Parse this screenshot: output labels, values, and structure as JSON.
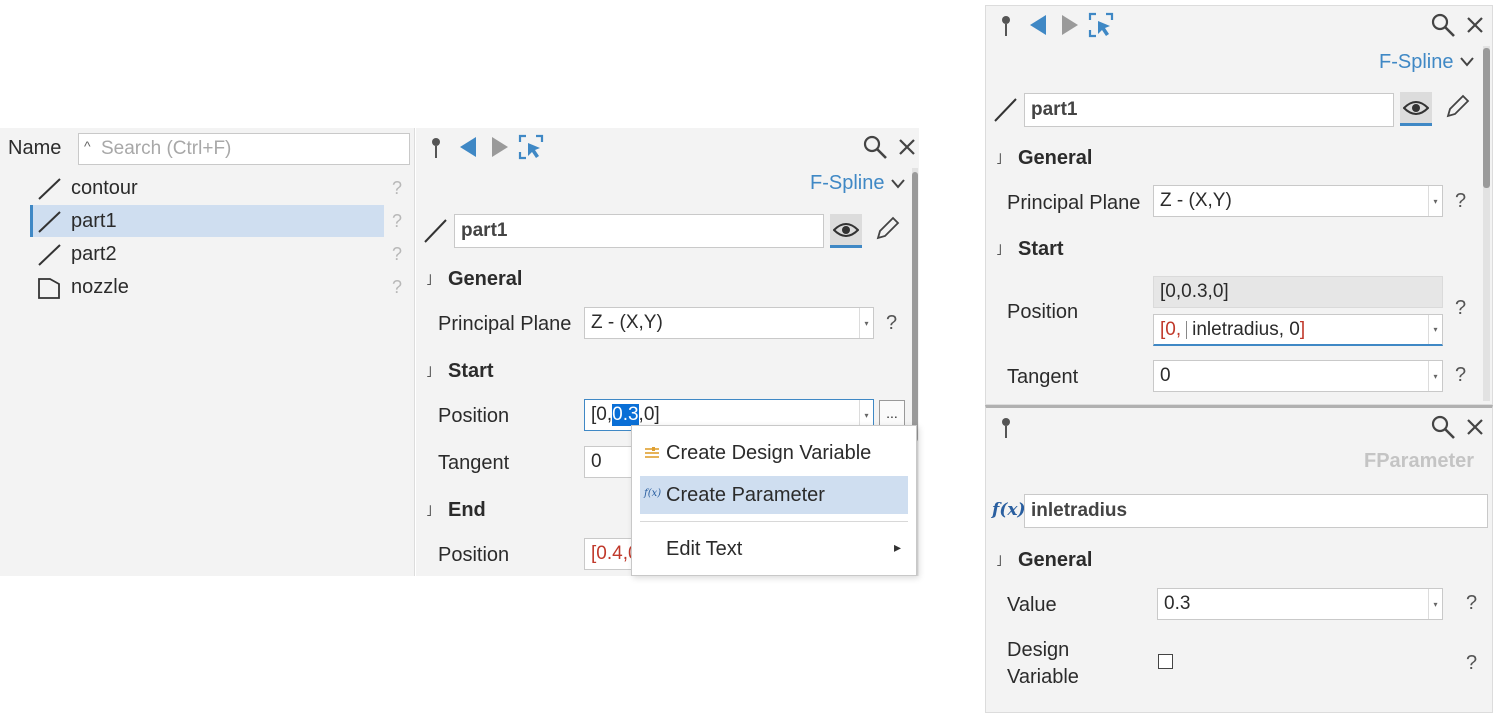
{
  "tree": {
    "header_label": "Name",
    "search_placeholder": "Search (Ctrl+F)",
    "items": [
      {
        "label": "contour",
        "help": "?"
      },
      {
        "label": "part1",
        "help": "?"
      },
      {
        "label": "part2",
        "help": "?"
      },
      {
        "label": "nozzle",
        "help": "?"
      }
    ]
  },
  "left_props": {
    "type_label": "F-Spline",
    "name_value": "part1",
    "sections": {
      "general": "General",
      "start": "Start",
      "end": "End"
    },
    "principal_plane_label": "Principal Plane",
    "principal_plane_value": "Z - (X,Y)",
    "position_label": "Position",
    "position_prefix": "[0,",
    "position_selected": "0.3",
    "position_suffix": ",0]",
    "browse_label": "...",
    "tangent_label": "Tangent",
    "tangent_value": "0",
    "end_position_label": "Position",
    "end_position_value": "[0.4,0",
    "help": "?"
  },
  "context_menu": {
    "items": [
      "Create Design Variable",
      "Create Parameter",
      "Edit Text"
    ],
    "submenu_arrow": "▸"
  },
  "right_props": {
    "type_label": "F-Spline",
    "name_value": "part1",
    "sections": {
      "general": "General",
      "start": "Start"
    },
    "principal_plane_label": "Principal Plane",
    "principal_plane_value": "Z - (X,Y)",
    "position_label": "Position",
    "position_readonly": "[0,0.3,0]",
    "position_expr_open": "[0,",
    "position_expr_param": "inletradius, 0",
    "position_expr_close": "]",
    "tangent_label": "Tangent",
    "tangent_value": "0",
    "help": "?"
  },
  "param_panel": {
    "type_label": "FParameter",
    "fx_label": "f(x)",
    "name_value": "inletradius",
    "section_general": "General",
    "value_label": "Value",
    "value_value": "0.3",
    "design_variable_label_1": "Design",
    "design_variable_label_2": "Variable",
    "help": "?"
  },
  "colors": {
    "accent": "#3f88c5",
    "selection": "#cfdef0",
    "text_selection": "#0a6fd6",
    "param_red": "#c0392b"
  }
}
